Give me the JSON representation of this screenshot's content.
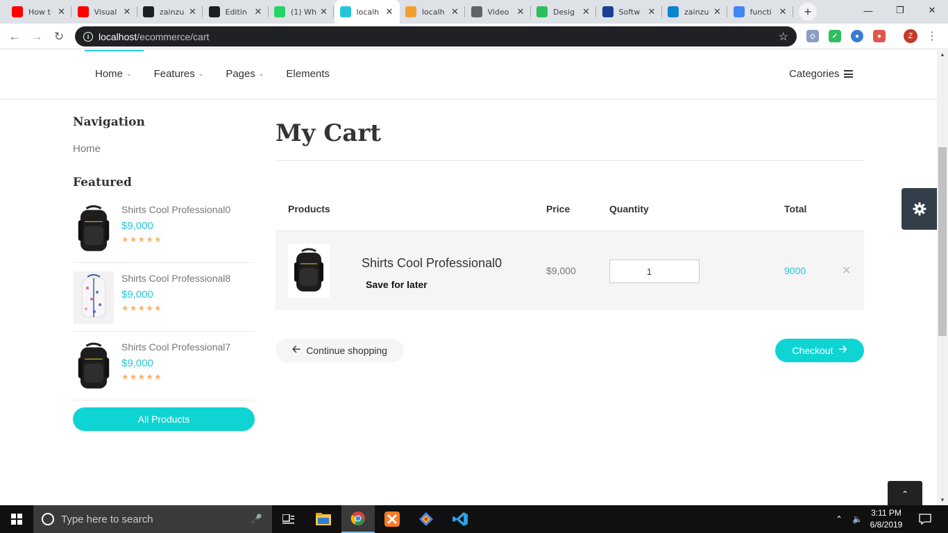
{
  "browser": {
    "tabs": [
      {
        "title": "How t",
        "icon": "youtube-icon",
        "color": "#ff0000"
      },
      {
        "title": "Visual",
        "icon": "youtube-icon",
        "color": "#ff0000"
      },
      {
        "title": "zainzu",
        "icon": "github-icon",
        "color": "#1b1f23"
      },
      {
        "title": "Editin",
        "icon": "github-icon",
        "color": "#1b1f23"
      },
      {
        "title": "(1) Wh",
        "icon": "whatsapp-icon",
        "color": "#25d366"
      },
      {
        "title": "localh",
        "icon": "lock-icon",
        "color": "#26c6da",
        "active": true
      },
      {
        "title": "localh",
        "icon": "phpmyadmin-icon",
        "color": "#f0a030"
      },
      {
        "title": "Video",
        "icon": "globe-icon",
        "color": "#5f6368"
      },
      {
        "title": "Desig",
        "icon": "design-icon",
        "color": "#2dbe60"
      },
      {
        "title": "Softw",
        "icon": "software-icon",
        "color": "#1c3f94"
      },
      {
        "title": "zainzu",
        "icon": "fn-icon",
        "color": "#0a84d0"
      },
      {
        "title": "functi",
        "icon": "google-icon",
        "color": "#4285f4"
      }
    ],
    "url_host": "localhost",
    "url_path": "/ecommerce/cart",
    "profile_initial": "Z"
  },
  "site": {
    "nav": [
      {
        "label": "Home",
        "has_dropdown": true
      },
      {
        "label": "Features",
        "has_dropdown": true
      },
      {
        "label": "Pages",
        "has_dropdown": true
      },
      {
        "label": "Elements",
        "has_dropdown": false
      }
    ],
    "categories_label": "Categories",
    "accent_color": "#26c6da",
    "button_color": "#0fd4d4"
  },
  "sidebar": {
    "nav_heading": "Navigation",
    "nav_link": "Home",
    "featured_heading": "Featured",
    "products": [
      {
        "name": "Shirts Cool Professional0",
        "price": "$9,000",
        "rating": 5,
        "image": "backpack-black"
      },
      {
        "name": "Shirts Cool Professional8",
        "price": "$9,000",
        "rating": 5,
        "image": "backpack-floral"
      },
      {
        "name": "Shirts Cool Professional7",
        "price": "$9,000",
        "rating": 5,
        "image": "backpack-black"
      }
    ],
    "all_products_label": "All Products"
  },
  "cart": {
    "title": "My Cart",
    "headers": {
      "products": "Products",
      "price": "Price",
      "quantity": "Quantity",
      "total": "Total"
    },
    "items": [
      {
        "name": "Shirts Cool Professional0",
        "save_label": "Save for later",
        "price": "$9,000",
        "quantity": "1",
        "total": "9000"
      }
    ],
    "continue_label": "Continue shopping",
    "checkout_label": "Checkout"
  },
  "taskbar": {
    "search_placeholder": "Type here to search",
    "time": "3:11 PM",
    "date": "6/8/2019"
  }
}
